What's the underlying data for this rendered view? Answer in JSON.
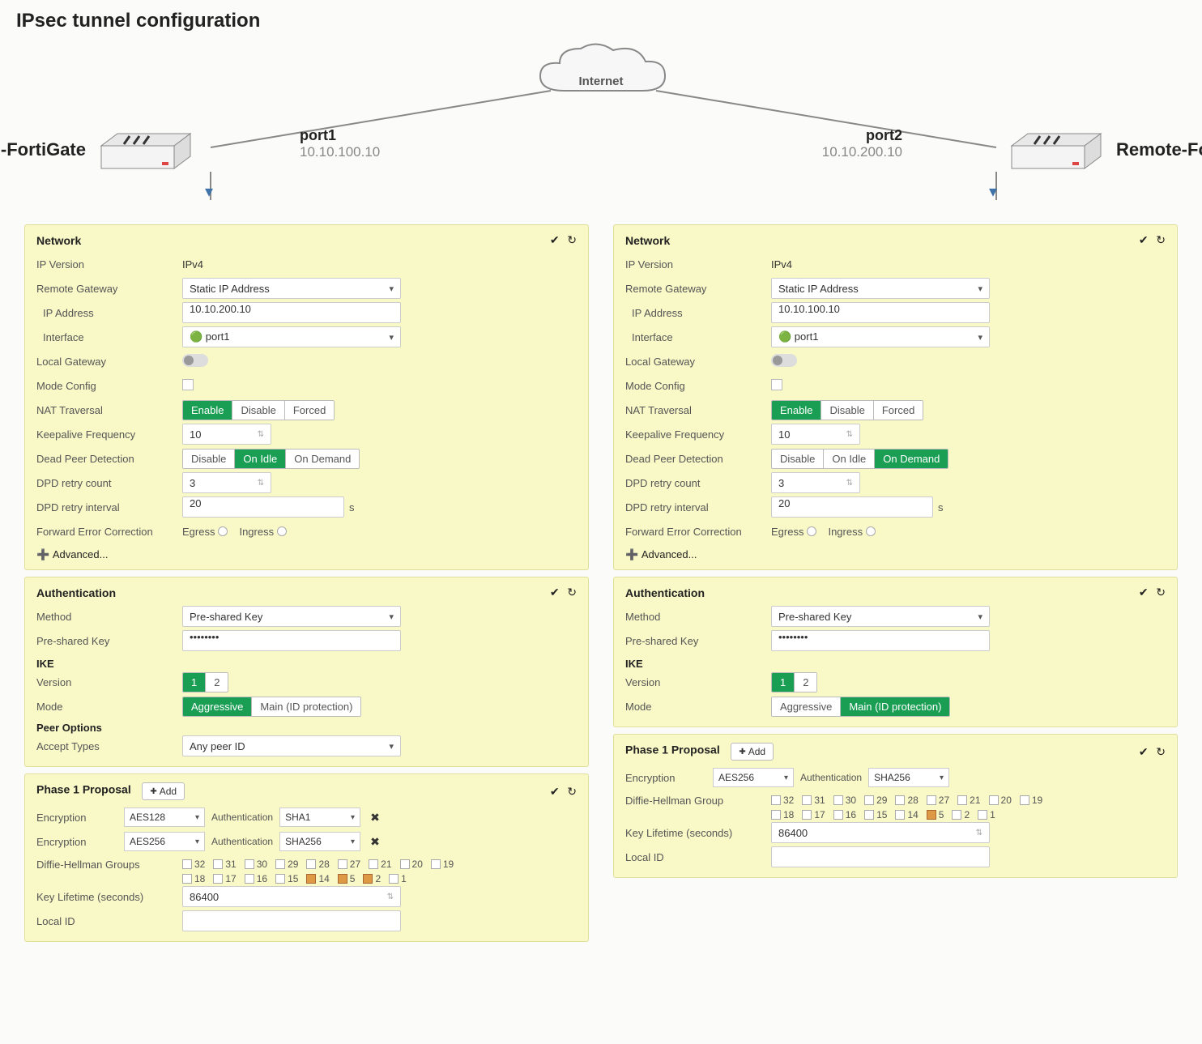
{
  "title": "IPsec tunnel configuration",
  "cloud": "Internet",
  "left_device": "HQ-FortiGate",
  "right_device": "Remote-FortiGate",
  "port_left": {
    "name": "port1",
    "ip": "10.10.100.10"
  },
  "port_right": {
    "name": "port2",
    "ip": "10.10.200.10"
  },
  "labels": {
    "network": "Network",
    "ip_version": "IP Version",
    "remote_gateway": "Remote Gateway",
    "ip_address": "IP Address",
    "interface": "Interface",
    "local_gateway": "Local Gateway",
    "mode_config": "Mode Config",
    "nat_traversal": "NAT Traversal",
    "nat_enable": "Enable",
    "nat_disable": "Disable",
    "nat_forced": "Forced",
    "keepalive": "Keepalive Frequency",
    "dpd": "Dead Peer Detection",
    "dpd_disable": "Disable",
    "dpd_onidle": "On Idle",
    "dpd_ondemand": "On Demand",
    "dpd_retry_count": "DPD retry count",
    "dpd_retry_interval": "DPD retry interval",
    "fec": "Forward Error Correction",
    "fec_egress": "Egress",
    "fec_ingress": "Ingress",
    "advanced": "Advanced...",
    "authentication": "Authentication",
    "method": "Method",
    "psk": "Pre-shared Key",
    "ike": "IKE",
    "version": "Version",
    "mode": "Mode",
    "mode_agg": "Aggressive",
    "mode_main": "Main (ID protection)",
    "peer_options": "Peer Options",
    "accept_types": "Accept Types",
    "phase1": "Phase 1 Proposal",
    "add": "Add",
    "encryption": "Encryption",
    "auth": "Authentication",
    "dh_groups": "Diffie-Hellman Groups",
    "dh_group": "Diffie-Hellman Group",
    "key_lifetime": "Key Lifetime (seconds)",
    "local_id": "Local ID",
    "seconds": "s"
  },
  "left": {
    "ip_version": "IPv4",
    "remote_gateway": "Static IP Address",
    "ip_address": "10.10.200.10",
    "interface": "🟢 port1",
    "nat": "Enable",
    "keepalive": "10",
    "dpd": "On Idle",
    "dpd_retry_count": "3",
    "dpd_retry_interval": "20",
    "method": "Pre-shared Key",
    "psk_value": "••••••••",
    "ike_version": "1",
    "mode": "Aggressive",
    "accept_types": "Any peer ID",
    "enc1": "AES128",
    "auth1": "SHA1",
    "enc2": "AES256",
    "auth2": "SHA256",
    "dh_groups": {
      "32": false,
      "31": false,
      "30": false,
      "29": false,
      "28": false,
      "27": false,
      "21": false,
      "20": false,
      "19": false,
      "18": false,
      "17": false,
      "16": false,
      "15": false,
      "14": true,
      "5": true,
      "2": true,
      "1": false
    },
    "key_lifetime": "86400",
    "local_id": ""
  },
  "right": {
    "ip_version": "IPv4",
    "remote_gateway": "Static IP Address",
    "ip_address": "10.10.100.10",
    "interface": "🟢 port1",
    "nat": "Enable",
    "keepalive": "10",
    "dpd": "On Demand",
    "dpd_retry_count": "3",
    "dpd_retry_interval": "20",
    "method": "Pre-shared Key",
    "psk_value": "••••••••",
    "ike_version": "1",
    "mode": "Main (ID protection)",
    "enc1": "AES256",
    "auth1": "SHA256",
    "dh_groups": {
      "32": false,
      "31": false,
      "30": false,
      "29": false,
      "28": false,
      "27": false,
      "21": false,
      "20": false,
      "19": false,
      "18": false,
      "17": false,
      "16": false,
      "15": false,
      "14": false,
      "5": true,
      "2": false,
      "1": false
    },
    "key_lifetime": "86400",
    "local_id": ""
  }
}
